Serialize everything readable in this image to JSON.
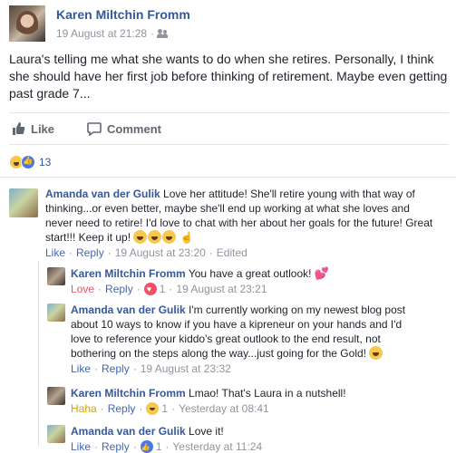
{
  "post": {
    "author": "Karen Miltchin Fromm",
    "timestamp": "19 August at 21:28",
    "text": "Laura's telling me what she wants to do when she retires. Personally, I think she should have her first job before thinking of retirement. Maybe even getting past grade 7...",
    "like_label": "Like",
    "comment_label": "Comment",
    "reaction_count": "13"
  },
  "comments": [
    {
      "author": "Amanda van der Gulik",
      "text": "Love her attitude! She'll retire young with that way of thinking...or even better, maybe she'll end up working at what she loves and never need to retire! I'd love to chat with her about her goals for the future! Great start!!! Keep it up!",
      "like_label": "Like",
      "reply_label": "Reply",
      "timestamp": "19 August at 23:20",
      "edited_label": "Edited"
    }
  ],
  "replies": [
    {
      "author": "Karen Miltchin Fromm",
      "text": "You have a great outlook!",
      "reaction_label": "Love",
      "reply_label": "Reply",
      "reaction_count": "1",
      "timestamp": "19 August at 23:21"
    },
    {
      "author": "Amanda van der Gulik",
      "text": "I'm currently working on my newest blog post about 10 ways to know if you have a kipreneur on your hands and I'd love to reference your kiddo's great outlook to the end result, not bothering on the steps along the way...just going for the Gold!",
      "like_label": "Like",
      "reply_label": "Reply",
      "timestamp": "19 August at 23:32"
    },
    {
      "author": "Karen Miltchin Fromm",
      "text": "Lmao! That's Laura in a nutshell!",
      "reaction_label": "Haha",
      "reply_label": "Reply",
      "reaction_count": "1",
      "timestamp": "Yesterday at 08:41"
    },
    {
      "author": "Amanda van der Gulik",
      "text": "Love it!",
      "like_label": "Like",
      "reply_label": "Reply",
      "reaction_count": "1",
      "timestamp": "Yesterday at 11:24"
    }
  ],
  "separators": {
    "dot": "·"
  },
  "colors": {
    "link": "#365899",
    "meta": "#90949c",
    "love": "#f25268",
    "haha": "#d7a300"
  },
  "icons": [
    "friends-icon",
    "like-thumb-icon",
    "comment-bubble-icon",
    "haha-reaction-icon",
    "like-reaction-icon",
    "love-reaction-icon",
    "heart-emoji-icon",
    "pointing-hand-emoji-icon"
  ]
}
